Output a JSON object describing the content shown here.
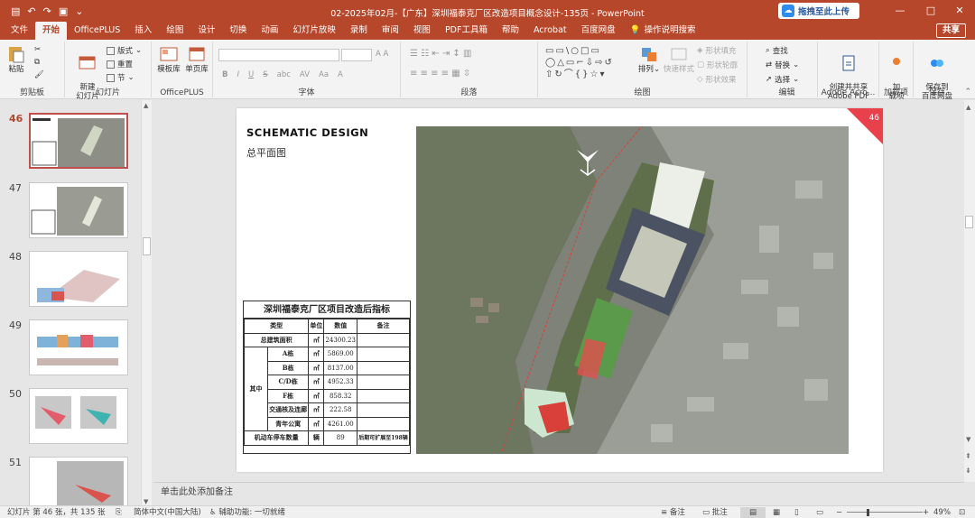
{
  "titlebar": {
    "title": "02-2025年02月-【广东】深圳福泰克厂区改造项目概念设计-135页  -  PowerPoint",
    "upload_label": "拖拽至此上传",
    "qat_icons": [
      "save-icon",
      "undo-icon",
      "redo-icon",
      "present-icon",
      "customize-icon"
    ]
  },
  "tabs": {
    "items": [
      "文件",
      "开始",
      "OfficePLUS",
      "插入",
      "绘图",
      "设计",
      "切换",
      "动画",
      "幻灯片放映",
      "录制",
      "审阅",
      "视图",
      "PDF工具箱",
      "帮助",
      "Acrobat",
      "百度网盘"
    ],
    "active": "开始",
    "tell_me": "操作说明搜索",
    "share": "共享"
  },
  "ribbon": {
    "clipboard": {
      "paste": "粘贴",
      "label": "剪贴板"
    },
    "slides": {
      "new_slide": "新建\n幻灯片",
      "layout": "版式",
      "reset": "重置",
      "section": "节",
      "label": "幻灯片"
    },
    "officeplus": {
      "template": "模板库",
      "single": "单页库",
      "label": "OfficePLUS"
    },
    "font": {
      "label": "字体",
      "buttons": [
        "B",
        "I",
        "U",
        "S",
        "abc",
        "AV",
        "Aa",
        "A"
      ]
    },
    "paragraph": {
      "label": "段落"
    },
    "drawing": {
      "arrange": "排列",
      "quick_styles": "快速样式",
      "fill": "形状填充",
      "outline": "形状轮廓",
      "effects": "形状效果",
      "label": "绘图"
    },
    "editing": {
      "find": "查找",
      "replace": "替换",
      "select": "选择",
      "label": "编辑"
    },
    "adobe": {
      "create": "创建并共享\nAdobe PDF",
      "label": "Adobe Acro..."
    },
    "addins": {
      "addin": "加\n载项",
      "label": "加载项"
    },
    "save": {
      "baidu": "保存到\n百度网盘",
      "label": "保存"
    }
  },
  "thumbnails": [
    {
      "num": "46",
      "current": true
    },
    {
      "num": "47",
      "current": false
    },
    {
      "num": "48",
      "current": false
    },
    {
      "num": "49",
      "current": false
    },
    {
      "num": "50",
      "current": false
    },
    {
      "num": "51",
      "current": false
    }
  ],
  "slide": {
    "title": "SCHEMATIC DESIGN",
    "subtitle": "总平面图",
    "page_num": "46",
    "table": {
      "title": "深圳福泰克厂区项目改造后指标",
      "headers": [
        "类型",
        "单位",
        "数值",
        "备注"
      ],
      "rows": [
        {
          "name": "总建筑面积",
          "unit": "㎡",
          "value": "24300.23",
          "note": ""
        },
        {
          "name": "A栋",
          "unit": "㎡",
          "value": "5869.00",
          "note": ""
        },
        {
          "name": "B栋",
          "unit": "㎡",
          "value": "8137.00",
          "note": ""
        },
        {
          "name": "C/D栋",
          "unit": "㎡",
          "value": "4952.33",
          "note": ""
        },
        {
          "name": "F栋",
          "unit": "㎡",
          "value": "858.32",
          "note": ""
        },
        {
          "name": "交通核及连廊",
          "unit": "㎡",
          "value": "222.58",
          "note": ""
        },
        {
          "name": "青年公寓",
          "unit": "㎡",
          "value": "4261.00",
          "note": ""
        },
        {
          "name": "机动车停车数量",
          "unit": "辆",
          "value": "89",
          "note": "后期可扩展至198辆"
        }
      ],
      "group_label": "其中"
    }
  },
  "notes": {
    "placeholder": "单击此处添加备注"
  },
  "statusbar": {
    "slide_info": "幻灯片 第 46 张，共 135 张",
    "language": "简体中文(中国大陆)",
    "accessibility": "辅助功能: 一切就绪",
    "notes": "备注",
    "comments": "批注",
    "zoom": "49%"
  },
  "colors": {
    "accent": "#b7472a",
    "corner": "#e8414b"
  }
}
